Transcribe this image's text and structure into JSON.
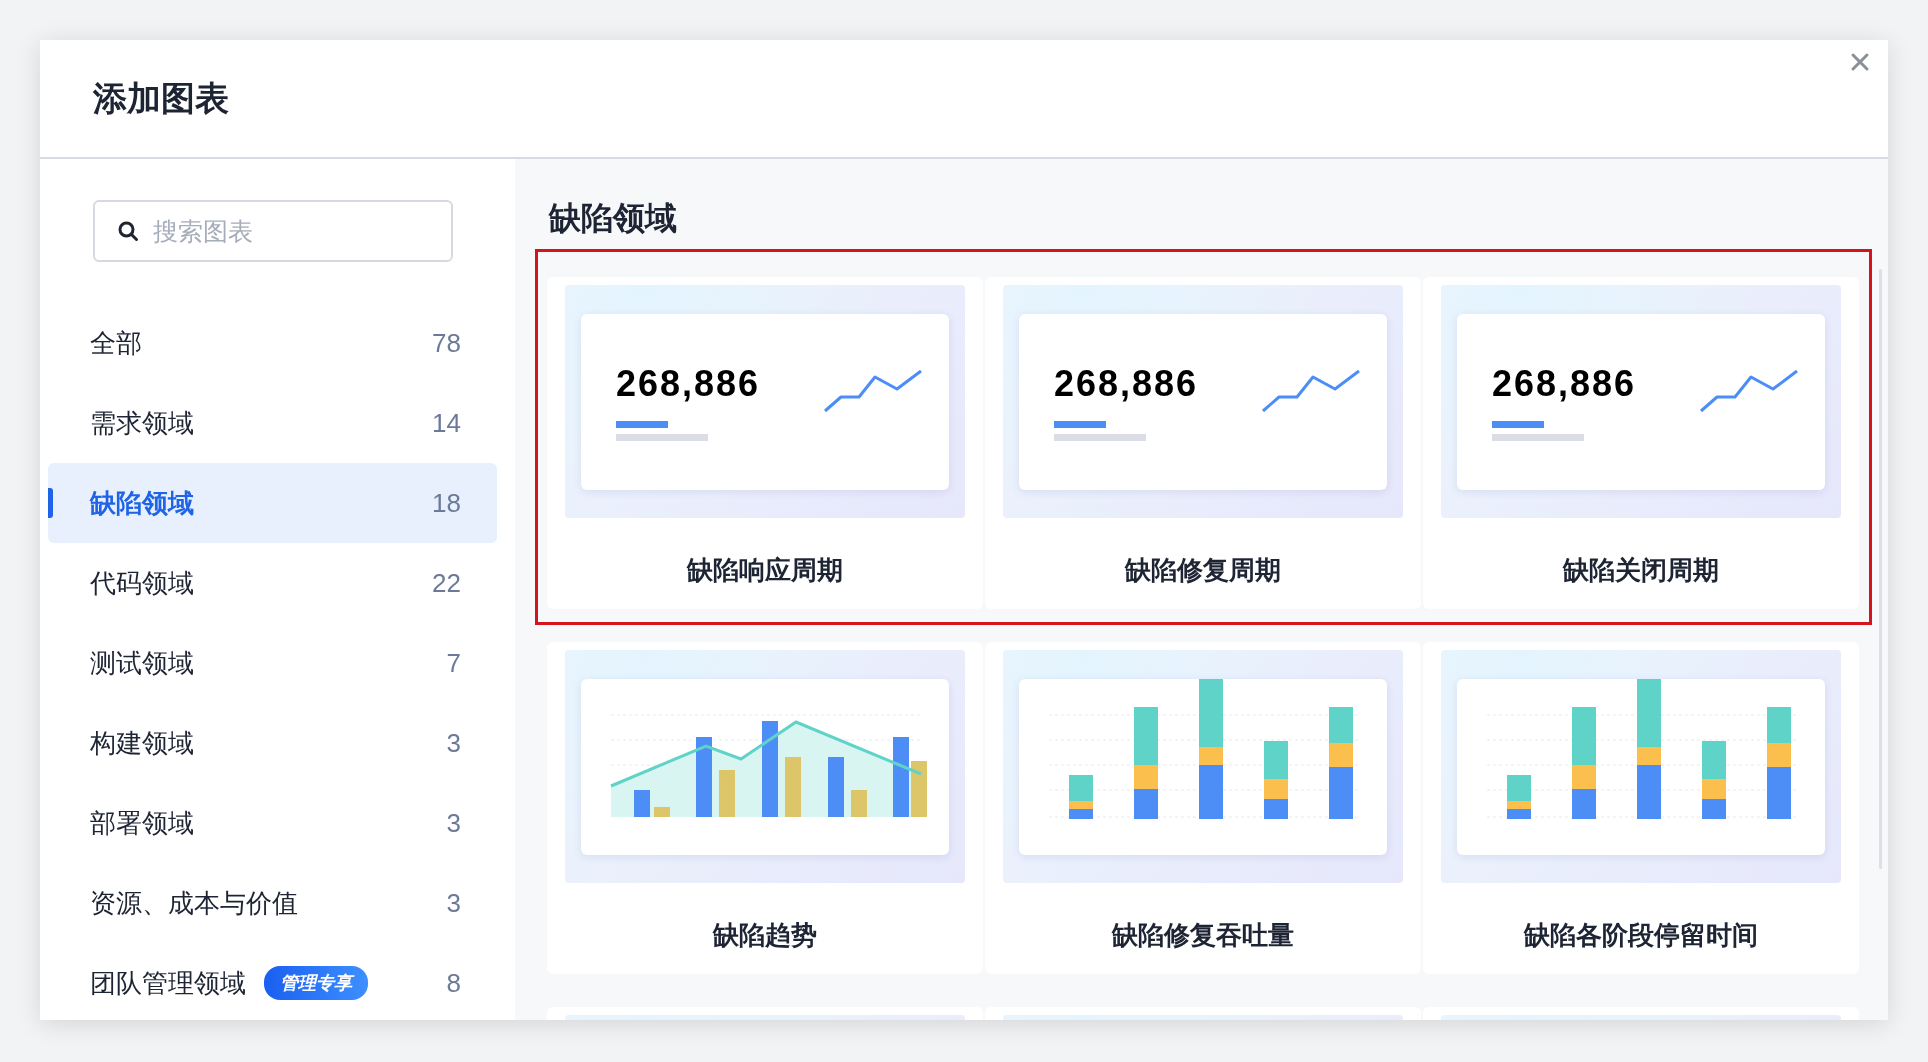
{
  "dialog": {
    "title": "添加图表"
  },
  "sidebar": {
    "search": {
      "placeholder": "搜索图表"
    },
    "items": [
      {
        "label": "全部",
        "count": "78",
        "selected": false
      },
      {
        "label": "需求领域",
        "count": "14",
        "selected": false
      },
      {
        "label": "缺陷领域",
        "count": "18",
        "selected": true
      },
      {
        "label": "代码领域",
        "count": "22",
        "selected": false
      },
      {
        "label": "测试领域",
        "count": "7",
        "selected": false
      },
      {
        "label": "构建领域",
        "count": "3",
        "selected": false
      },
      {
        "label": "部署领域",
        "count": "3",
        "selected": false
      },
      {
        "label": "资源、成本与价值",
        "count": "3",
        "selected": false
      },
      {
        "label": "团队管理领域",
        "badge": "管理专享",
        "count": "8",
        "selected": false
      }
    ]
  },
  "section": {
    "title": "缺陷领域",
    "rows": [
      {
        "highlighted": true,
        "cards": [
          {
            "kind": "metric",
            "value": "268,886",
            "title": "缺陷响应周期"
          },
          {
            "kind": "metric",
            "value": "268,886",
            "title": "缺陷修复周期"
          },
          {
            "kind": "metric",
            "value": "268,886",
            "title": "缺陷关闭周期"
          }
        ]
      },
      {
        "highlighted": false,
        "cards": [
          {
            "kind": "trend",
            "title": "缺陷趋势"
          },
          {
            "kind": "stacked",
            "title": "缺陷修复吞吐量"
          },
          {
            "kind": "stacked",
            "title": "缺陷各阶段停留时间"
          }
        ]
      },
      {
        "highlighted": false,
        "cards": [
          {
            "kind": "partial"
          },
          {
            "kind": "partial"
          },
          {
            "kind": "partial"
          }
        ]
      }
    ]
  }
}
